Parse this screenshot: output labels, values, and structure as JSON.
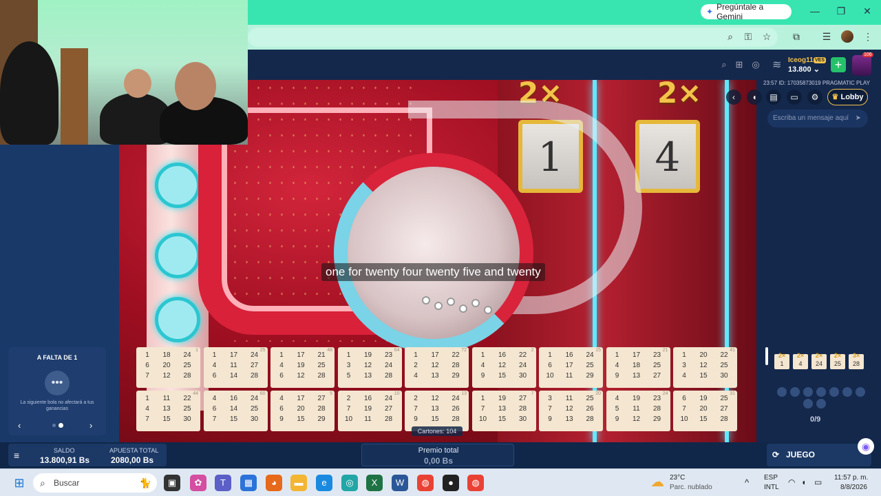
{
  "browser": {
    "gemini_label": "Pregúntale a Gemini",
    "window_controls": [
      "—",
      "❐",
      "✕"
    ]
  },
  "game_header": {
    "username": "Iceog11",
    "currency_badge": "VES",
    "balance": "13.800",
    "level": "106"
  },
  "right_panel": {
    "game_id": "23:57 ID: 17035873019 PRAGMATIC PLAY",
    "lobby_label": "Lobby",
    "chat_placeholder": "Escriba un mensaje aquí",
    "multipliers": [
      {
        "x": "2×",
        "n": "1"
      },
      {
        "x": "2×",
        "n": "4"
      },
      {
        "x": "2×",
        "n": "24"
      },
      {
        "x": "2×",
        "n": "25"
      },
      {
        "x": "3×",
        "n": "28"
      }
    ],
    "count": "0/9"
  },
  "video": {
    "subtitle": "one for twenty four twenty five and twenty",
    "panel_numbers": [
      "1",
      "4"
    ],
    "panel_mults": [
      "2×",
      "2×"
    ]
  },
  "falta": {
    "title": "A FALTA DE 1",
    "text": "La siguiente bola no afectará a tus ganancias"
  },
  "cards": [
    {
      "id": "1",
      "nums": [
        "1",
        "18",
        "24",
        "6",
        "20",
        "25",
        "7",
        "12",
        "28"
      ]
    },
    {
      "id": "25",
      "nums": [
        "1",
        "17",
        "24",
        "4",
        "11",
        "27",
        "6",
        "14",
        "28"
      ]
    },
    {
      "id": "48",
      "nums": [
        "1",
        "17",
        "21",
        "4",
        "19",
        "25",
        "6",
        "12",
        "28"
      ]
    },
    {
      "id": "64",
      "nums": [
        "1",
        "19",
        "23",
        "3",
        "12",
        "24",
        "5",
        "13",
        "28"
      ]
    },
    {
      "id": "72",
      "nums": [
        "1",
        "17",
        "22",
        "2",
        "12",
        "28",
        "4",
        "13",
        "29"
      ]
    },
    {
      "id": "2",
      "nums": [
        "1",
        "16",
        "22",
        "4",
        "12",
        "24",
        "9",
        "15",
        "30"
      ]
    },
    {
      "id": "15",
      "nums": [
        "1",
        "16",
        "24",
        "6",
        "17",
        "25",
        "10",
        "11",
        "29"
      ]
    },
    {
      "id": "21",
      "nums": [
        "1",
        "17",
        "23",
        "4",
        "18",
        "25",
        "9",
        "13",
        "27"
      ]
    },
    {
      "id": "41",
      "nums": [
        "1",
        "20",
        "22",
        "3",
        "12",
        "25",
        "4",
        "15",
        "30"
      ]
    },
    {
      "id": "44",
      "nums": [
        "1",
        "11",
        "22",
        "4",
        "13",
        "25",
        "7",
        "15",
        "30"
      ]
    },
    {
      "id": "60",
      "nums": [
        "4",
        "16",
        "24",
        "6",
        "14",
        "25",
        "7",
        "15",
        "30"
      ]
    },
    {
      "id": "5",
      "nums": [
        "4",
        "17",
        "27",
        "6",
        "20",
        "28",
        "9",
        "15",
        "29"
      ]
    },
    {
      "id": "10",
      "nums": [
        "2",
        "16",
        "24",
        "7",
        "19",
        "27",
        "10",
        "11",
        "28"
      ]
    },
    {
      "id": "13",
      "nums": [
        "2",
        "12",
        "24",
        "7",
        "13",
        "26",
        "9",
        "15",
        "28"
      ]
    },
    {
      "id": "7",
      "nums": [
        "1",
        "19",
        "27",
        "7",
        "13",
        "28",
        "10",
        "15",
        "30"
      ]
    },
    {
      "id": "20",
      "nums": [
        "3",
        "11",
        "25",
        "7",
        "12",
        "26",
        "9",
        "13",
        "28"
      ]
    },
    {
      "id": "24",
      "nums": [
        "4",
        "19",
        "23",
        "5",
        "11",
        "28",
        "9",
        "12",
        "29"
      ]
    },
    {
      "id": "31",
      "nums": [
        "6",
        "19",
        "25",
        "7",
        "20",
        "27",
        "10",
        "15",
        "28"
      ]
    }
  ],
  "cartones": "Cartones: 104",
  "bottom": {
    "saldo_label": "SALDO",
    "saldo_value": "13.800,91 Bs",
    "apuesta_label": "APUESTA TOTAL",
    "apuesta_value": "2080,00 Bs",
    "premio_label": "Premio total",
    "premio_value": "0,00 Bs",
    "auto_label": "JUEGO AUTOMÁTICO"
  },
  "taskbar": {
    "search_label": "Buscar",
    "weather_temp": "23°C",
    "weather_desc": "Parc. nublado",
    "lang1": "ESP",
    "lang2": "INTL",
    "time": "11:57 p. m.",
    "date": "8/8/2026"
  },
  "colors": {
    "accent_green": "#38e5b0",
    "panel_navy": "#14284c",
    "card_cream": "#f4e6d0",
    "gold": "#f5c34a"
  }
}
